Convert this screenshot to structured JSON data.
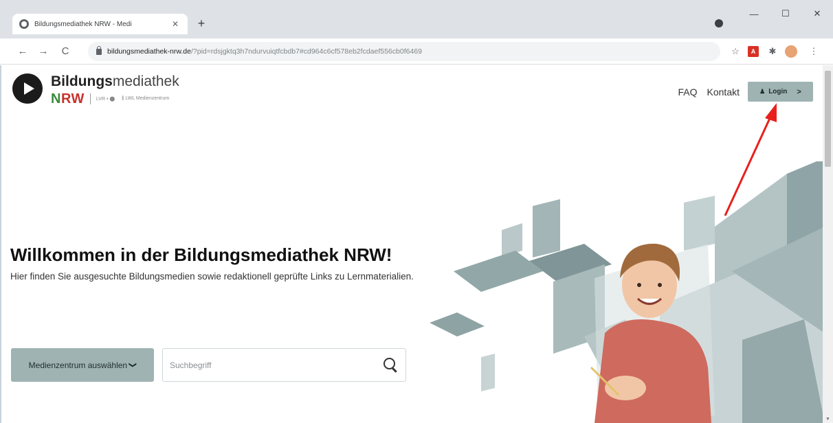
{
  "browser": {
    "tab_title": "Bildungsmediathek NRW - Medi",
    "tab_close": "✕",
    "new_tab": "+",
    "url_host": "bildungsmediathek-nrw.de",
    "url_rest": "/?pid=rdsjgktq3h7ndurvuiqtfcbdb7#cd964c6cf578eb2fcdaef556cb0f6469",
    "window_controls": {
      "minimize": "—",
      "maximize": "☐",
      "close": "✕"
    },
    "nav": {
      "back": "←",
      "forward": "→",
      "reload": "C"
    },
    "extensions": {
      "star": "☆",
      "pdf": "A",
      "puzzle": "✱",
      "menu": "⋮"
    }
  },
  "site": {
    "logo": {
      "title_bold": "Bildungs",
      "title_light": "mediathek",
      "nrw_n": "N",
      "nrw_rw": "RW",
      "partner1": "LVR • ⬤",
      "partner2": "⫼ LWL Medienzentrum"
    },
    "nav": {
      "faq": "FAQ",
      "contact": "Kontakt",
      "login": "Login",
      "login_icon": "♟",
      "login_chevron": ">"
    },
    "hero": {
      "title": "Willkommen in der Bildungsmediathek NRW!",
      "description": "Hier finden Sie ausgesuchte Bildungsmedien sowie redaktionell geprüfte Links zu Lernmaterialien."
    },
    "search": {
      "select_label": "Medienzentrum auswählen",
      "select_chevron": "❯",
      "placeholder": "Suchbegriff"
    }
  },
  "colors": {
    "accent": "#9fb3b3",
    "annotation_arrow": "#e8201c"
  }
}
